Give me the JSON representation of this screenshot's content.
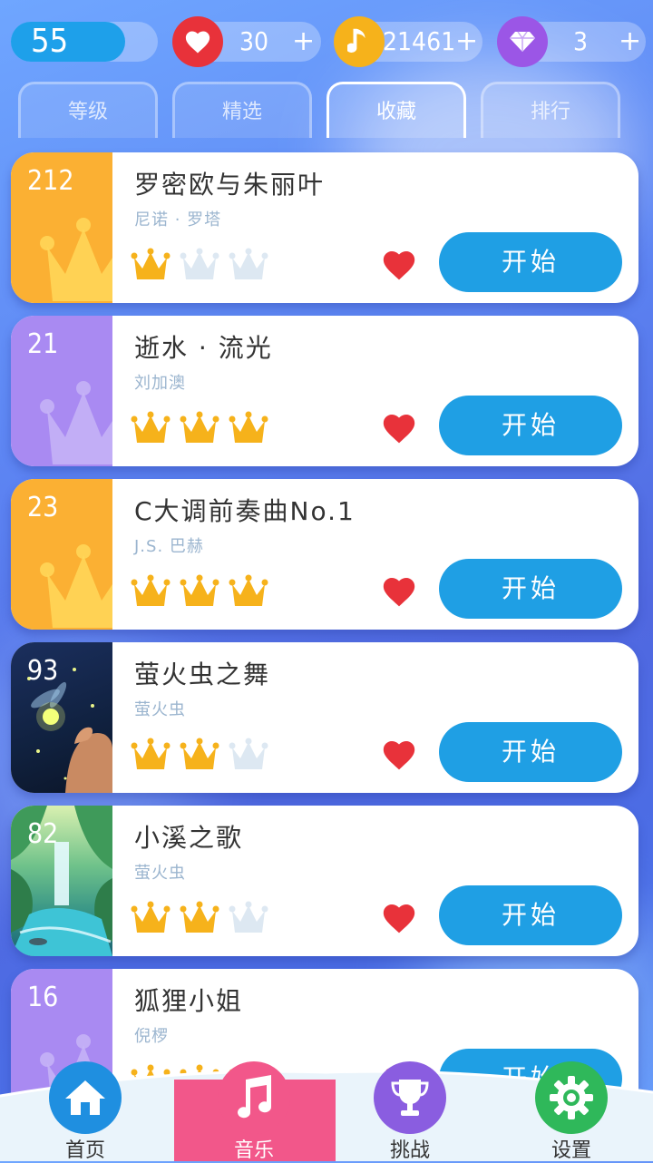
{
  "stats": {
    "level": "55",
    "level_progress": 0.78,
    "lives": "30",
    "notes": "21461",
    "gems": "3",
    "plus": "+"
  },
  "tabs": [
    {
      "label": "等级",
      "active": false
    },
    {
      "label": "精选",
      "active": false
    },
    {
      "label": "收藏",
      "active": true
    },
    {
      "label": "排行",
      "active": false
    }
  ],
  "songs": [
    {
      "rank": "212",
      "title": "罗密欧与朱丽叶",
      "artist": "尼诺 · 罗塔",
      "stars": 1,
      "thumb": "orange-crown"
    },
    {
      "rank": "21",
      "title": "逝水 · 流光",
      "artist": "刘加澳",
      "stars": 3,
      "thumb": "purple-crown"
    },
    {
      "rank": "23",
      "title": "C大调前奏曲No.1",
      "artist": "J.S. 巴赫",
      "stars": 3,
      "thumb": "orange-crown"
    },
    {
      "rank": "93",
      "title": "萤火虫之舞",
      "artist": "萤火虫",
      "stars": 2,
      "thumb": "firefly-art"
    },
    {
      "rank": "82",
      "title": "小溪之歌",
      "artist": "萤火虫",
      "stars": 2,
      "thumb": "waterfall-art"
    },
    {
      "rank": "16",
      "title": "狐狸小姐",
      "artist": "倪椤",
      "stars": 3,
      "thumb": "purple-crown"
    }
  ],
  "start_label": "开始",
  "nav": [
    {
      "label": "首页",
      "icon": "home-icon",
      "color": "#1f8fe0"
    },
    {
      "label": "音乐",
      "icon": "music-note-icon",
      "color": "#f2578a",
      "active": true
    },
    {
      "label": "挑战",
      "icon": "trophy-icon",
      "color": "#8a5de0"
    },
    {
      "label": "设置",
      "icon": "gear-icon",
      "color": "#2fb85a"
    }
  ],
  "colors": {
    "orange": "#fbb033",
    "purple": "#a98af2",
    "button": "#1f9fe4",
    "heart": "#e8323a",
    "crown_gold": "#f6b21b",
    "crown_empty": "#dde8f2"
  }
}
